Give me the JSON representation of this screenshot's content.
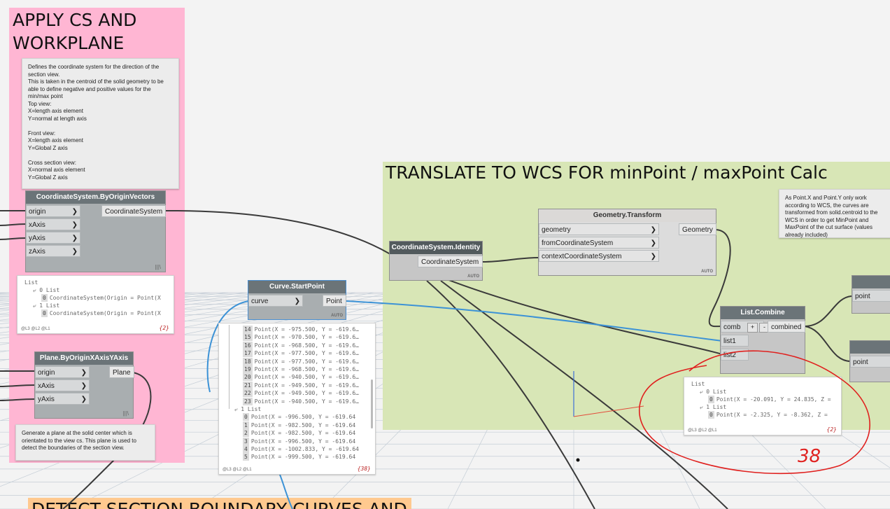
{
  "groups": {
    "apply_cs": {
      "title": "APPLY CS AND\nWORKPLANE",
      "color": "#ffb6d3"
    },
    "translate": {
      "title": "TRANSLATE TO WCS FOR minPoint / maxPoint Calc",
      "color": "#d8e6b6"
    },
    "detect": {
      "title": "DETECT SECTION BOUNDARY CURVES AND",
      "color": "#ffc98f"
    }
  },
  "notes": {
    "cs_note": "Defines the coordinate system for the direction of the section view.\nThis is taken in the centroid of the solid geometry to be able to define negative and positive values for the min/max point\nTop view:\nX=length axis element\nY=normal at length axis\n\nFront view:\nX=length axis element\nY=Global Z axis\n\nCross section view:\nX=normal axis element\nY=Global Z axis",
    "plane_note": "Generate a plane at the solid center which is orientated to the view cs. This plane is used to detect the boundaries of the section view.",
    "wcs_note": "As Point.X and Point.Y only work according to WCS, the curves are transformed from solid.centroid to the WCS in order to get MinPoint and MaxPoint of the cut surface (values already included)"
  },
  "nodes": {
    "cs_by_origin": {
      "title": "CoordinateSystem.ByOriginVectors",
      "inputs": [
        "origin",
        "xAxis",
        "yAxis",
        "zAxis"
      ],
      "output": "CoordinateSystem",
      "lacing": "|||\\"
    },
    "plane_by_origin": {
      "title": "Plane.ByOriginXAxisYAxis",
      "inputs": [
        "origin",
        "xAxis",
        "yAxis"
      ],
      "output": "Plane",
      "lacing": "|||\\"
    },
    "curve_startpoint": {
      "title": "Curve.StartPoint",
      "input": "curve",
      "output": "Point",
      "auto": "AUTO"
    },
    "cs_identity": {
      "title": "CoordinateSystem.Identity",
      "output": "CoordinateSystem",
      "auto": "AUTO"
    },
    "geometry_transform": {
      "title": "Geometry.Transform",
      "inputs": [
        "geometry",
        "fromCoordinateSystem",
        "contextCoordinateSystem"
      ],
      "output": "Geometry",
      "auto": "AUTO"
    },
    "list_combine": {
      "title": "List.Combine",
      "inputs": [
        "comb",
        "list1",
        "list2"
      ],
      "output": "combined",
      "plus": "+",
      "minus": "-"
    },
    "right_node_1": {
      "input": "point"
    },
    "right_node_2": {
      "input": "point"
    }
  },
  "previews": {
    "cs_preview": {
      "lines": [
        {
          "text": "List",
          "indent": 0
        },
        {
          "text": "⤶ 0 List",
          "indent": 1
        },
        {
          "idx": "0",
          "text": "CoordinateSystem(Origin = Point(X",
          "indent": 2
        },
        {
          "text": "⤶ 1 List",
          "indent": 1
        },
        {
          "idx": "0",
          "text": "CoordinateSystem(Origin = Point(X",
          "indent": 2
        }
      ],
      "levels": "@L3 @L2 @L1",
      "count": "{2}"
    },
    "startpoint_preview": {
      "lines": [
        {
          "idx": "14",
          "text": "Point(X = -975.500, Y = -619.6…"
        },
        {
          "idx": "15",
          "text": "Point(X = -970.500, Y = -619.6…"
        },
        {
          "idx": "16",
          "text": "Point(X = -968.500, Y = -619.6…"
        },
        {
          "idx": "17",
          "text": "Point(X = -977.500, Y = -619.6…"
        },
        {
          "idx": "18",
          "text": "Point(X = -977.500, Y = -619.6…"
        },
        {
          "idx": "19",
          "text": "Point(X = -968.500, Y = -619.6…"
        },
        {
          "idx": "20",
          "text": "Point(X = -940.500, Y = -619.6…"
        },
        {
          "idx": "21",
          "text": "Point(X = -949.500, Y = -619.6…"
        },
        {
          "idx": "22",
          "text": "Point(X = -949.500, Y = -619.6…"
        },
        {
          "idx": "23",
          "text": "Point(X = -940.500, Y = -619.6…"
        },
        {
          "header": "⤶ 1 List"
        },
        {
          "idx": "0",
          "text": "Point(X = -996.500, Y = -619.64"
        },
        {
          "idx": "1",
          "text": "Point(X = -982.500, Y = -619.64"
        },
        {
          "idx": "2",
          "text": "Point(X = -982.500, Y = -619.64"
        },
        {
          "idx": "3",
          "text": "Point(X = -996.500, Y = -619.64"
        },
        {
          "idx": "4",
          "text": "Point(X = -1002.833, Y = -619.64"
        },
        {
          "idx": "5",
          "text": "Point(X = -999.500, Y = -619.64"
        }
      ],
      "levels": "@L3 @L2 @L1",
      "count": "{38}"
    },
    "combine_preview": {
      "lines": [
        {
          "text": "List",
          "indent": 0
        },
        {
          "text": "⤶ 0 List",
          "indent": 1
        },
        {
          "idx": "0",
          "text": "Point(X = -20.091, Y = 24.835, Z =",
          "indent": 2
        },
        {
          "text": "⤶ 1 List",
          "indent": 1
        },
        {
          "idx": "0",
          "text": "Point(X = -2.325, Y = -8.362, Z =",
          "indent": 2
        }
      ],
      "levels": "@L3 @L2 @L1",
      "count": "{2}"
    }
  },
  "annotation": {
    "text": "38",
    "color": "#e0201e"
  },
  "colors": {
    "wire_dark": "#3a3a3a",
    "wire_blue": "#3c92d6",
    "canvas": "#f3f3f3",
    "axis_red": "#e34b3a",
    "axis_blue": "#3d6fd8"
  }
}
